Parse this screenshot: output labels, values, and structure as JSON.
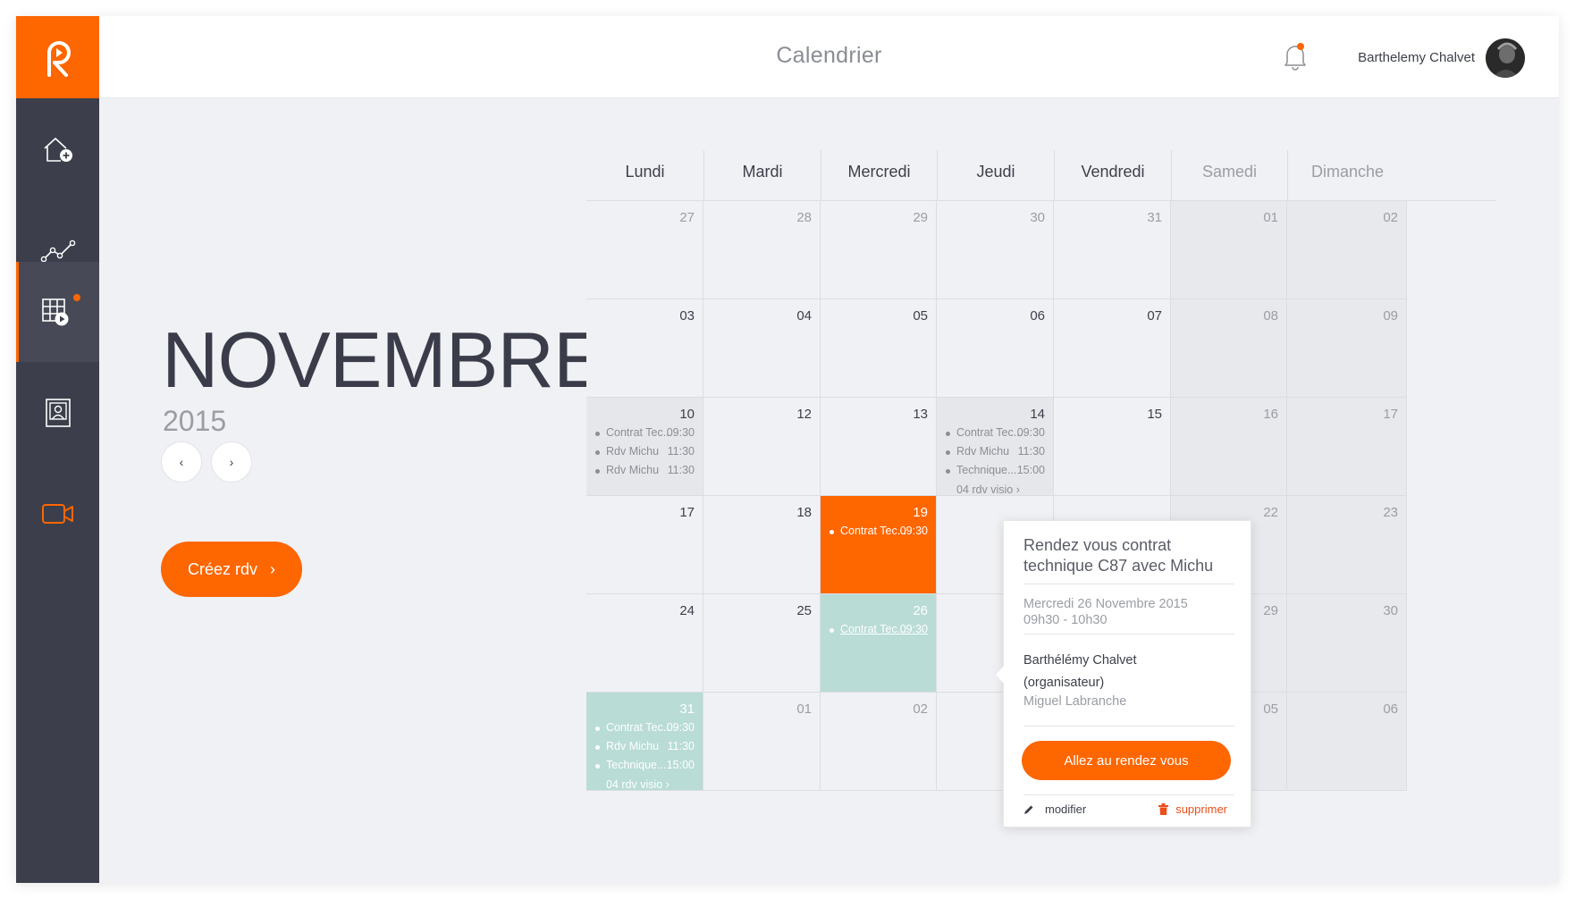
{
  "header": {
    "title": "Calendrier",
    "user_name": "Barthelemy Chalvet"
  },
  "sidebar": {
    "items": [
      {
        "icon": "home-add-icon"
      },
      {
        "icon": "analytics-icon"
      },
      {
        "icon": "calendar-play-icon",
        "active": true
      },
      {
        "icon": "contact-card-icon"
      },
      {
        "icon": "video-camera-icon"
      }
    ]
  },
  "month_panel": {
    "month": "NOVEMBRE",
    "year": "2015",
    "prev_label": "‹",
    "next_label": "›",
    "create_label": "Créez rdv",
    "create_arrow": "›"
  },
  "calendar": {
    "day_names": [
      "Lundi",
      "Mardi",
      "Mercredi",
      "Jeudi",
      "Vendredi",
      "Samedi",
      "Dimanche"
    ],
    "weeks": [
      [
        {
          "day": "27",
          "other": true
        },
        {
          "day": "28",
          "other": true
        },
        {
          "day": "29",
          "other": true
        },
        {
          "day": "30",
          "other": true
        },
        {
          "day": "31",
          "other": true
        },
        {
          "day": "01",
          "weekend": true
        },
        {
          "day": "02",
          "weekend": true
        }
      ],
      [
        {
          "day": "03"
        },
        {
          "day": "04"
        },
        {
          "day": "05"
        },
        {
          "day": "06"
        },
        {
          "day": "07"
        },
        {
          "day": "08",
          "weekend": true
        },
        {
          "day": "09",
          "weekend": true
        }
      ],
      [
        {
          "day": "10",
          "style": "gray",
          "events": [
            {
              "title": "Contrat Tec...",
              "time": "09:30"
            },
            {
              "title": "Rdv Michu",
              "time": "11:30"
            },
            {
              "title": "Rdv Michu",
              "time": "11:30"
            }
          ]
        },
        {
          "day": "12"
        },
        {
          "day": "13"
        },
        {
          "day": "14",
          "style": "gray",
          "events": [
            {
              "title": "Contrat Tec...",
              "time": "09:30"
            },
            {
              "title": "Rdv Michu",
              "time": "11:30"
            },
            {
              "title": "Technique...",
              "time": "15:00"
            }
          ],
          "more": "04 rdv visio"
        },
        {
          "day": "15"
        },
        {
          "day": "16",
          "weekend": true
        },
        {
          "day": "17",
          "weekend": true
        }
      ],
      [
        {
          "day": "17"
        },
        {
          "day": "18"
        },
        {
          "day": "19",
          "style": "orange",
          "events": [
            {
              "title": "Contrat Tec...",
              "time": "09:30"
            }
          ]
        },
        {
          "day": ""
        },
        {
          "day": ""
        },
        {
          "day": "22",
          "weekend": true
        },
        {
          "day": "23",
          "weekend": true
        }
      ],
      [
        {
          "day": "24"
        },
        {
          "day": "25"
        },
        {
          "day": "26",
          "style": "teal",
          "selected": true,
          "events": [
            {
              "title": "Contrat Tec...",
              "time": "09:30"
            }
          ]
        },
        {
          "day": ""
        },
        {
          "day": ""
        },
        {
          "day": "29",
          "weekend": true
        },
        {
          "day": "30",
          "weekend": true
        }
      ],
      [
        {
          "day": "31",
          "style": "teal",
          "last": true,
          "events": [
            {
              "title": "Contrat Tec...",
              "time": "09:30"
            },
            {
              "title": "Rdv Michu",
              "time": "11:30"
            },
            {
              "title": "Technique...",
              "time": "15:00"
            }
          ],
          "more": "04 rdv visio"
        },
        {
          "day": "01",
          "other": true
        },
        {
          "day": "02",
          "other": true
        },
        {
          "day": ""
        },
        {
          "day": ""
        },
        {
          "day": "05",
          "weekend": true,
          "other": true
        },
        {
          "day": "06",
          "weekend": true,
          "other": true
        }
      ]
    ]
  },
  "popover": {
    "title": "Rendez vous contrat technique C87 avec Michu",
    "date": "Mercredi 26 Novembre 2015",
    "time": "09h30 - 10h30",
    "organizer": "Barthélémy Chalvet (organisateur)",
    "participant": "Miguel Labranche",
    "go_label": "Allez au rendez vous",
    "modify_label": "modifier",
    "delete_label": "supprimer"
  },
  "colors": {
    "accent": "#fe6600",
    "sidebar": "#3c3f4b",
    "teal": "#b9dcd6"
  }
}
